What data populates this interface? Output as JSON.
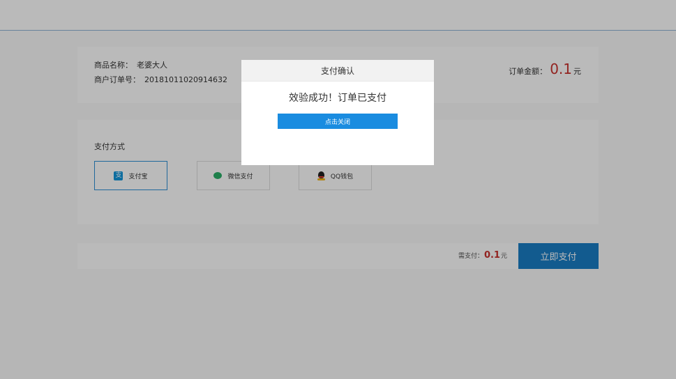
{
  "order": {
    "product_label": "商品名称：",
    "product_value": "老婆大人",
    "order_no_label": "商户订单号：",
    "order_no_value": "20181011020914632",
    "amount_label": "订单金额：",
    "amount_value": "0.1",
    "amount_unit": "元"
  },
  "payment": {
    "title": "支付方式",
    "methods": [
      {
        "label": "支付宝",
        "icon": "alipay-icon",
        "selected": true,
        "color": "#1296db"
      },
      {
        "label": "微信支付",
        "icon": "wechat-icon",
        "selected": false,
        "color": "#2aae67"
      },
      {
        "label": "QQ钱包",
        "icon": "qq-icon",
        "selected": false,
        "color": "#222222"
      }
    ],
    "ali_glyph": "支"
  },
  "paybar": {
    "need_label": "需支付：",
    "need_value": "0.1",
    "need_unit": "元",
    "pay_button": "立即支付"
  },
  "modal": {
    "title": "支付确认",
    "message": "效验成功！订单已支付",
    "close_button": "点击关闭"
  },
  "colors": {
    "accent": "#1a7dc4",
    "price": "#c9302c",
    "modal_button": "#1a8ce0"
  }
}
